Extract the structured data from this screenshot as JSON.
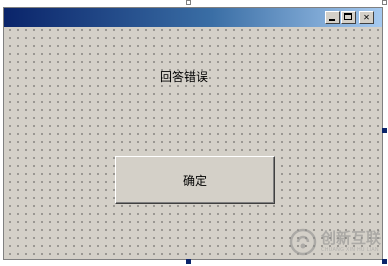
{
  "window": {
    "title": "",
    "controls": {
      "minimize_icon": "minimize-icon",
      "maximize_icon": "maximize-icon",
      "close_icon": "close-icon",
      "close_glyph": "✕"
    }
  },
  "form": {
    "message_label": "回答错误",
    "ok_button": "确定"
  },
  "watermark": {
    "text": "创新互联",
    "subtext": "CHUANG XIN HU LIAN"
  },
  "colors": {
    "form_background": "#d4d0c8",
    "titlebar_start": "#0a246a",
    "titlebar_end": "#a6caf0",
    "selection_handle": "#0a246a"
  }
}
